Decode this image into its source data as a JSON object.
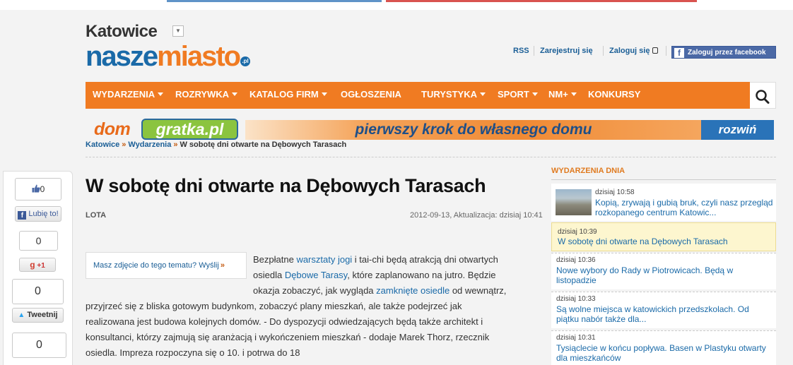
{
  "header": {
    "city": "Katowice",
    "logo_part1": "nasze",
    "logo_part2": "miasto",
    "logo_suffix": ".pl",
    "links": {
      "rss": "RSS",
      "register": "Zarejestruj się",
      "login": "Zaloguj się",
      "facebook_login": "Zaloguj przez facebook"
    }
  },
  "nav": {
    "items": [
      {
        "label": "WYDARZENIA"
      },
      {
        "label": "ROZRYWKA"
      },
      {
        "label": "KATALOG FIRM"
      },
      {
        "label": "OGŁOSZENIA"
      },
      {
        "label": "TURYSTYKA"
      },
      {
        "label": "SPORT"
      },
      {
        "label": "NM+"
      },
      {
        "label": "KONKURSY"
      }
    ]
  },
  "banner": {
    "dom": "dom",
    "gratka": "gratka.pl",
    "slogan": "pierwszy krok do własnego domu",
    "expand": "rozwiń"
  },
  "breadcrumb": {
    "home": "Katowice",
    "section": "Wydarzenia",
    "current": "W sobotę dni otwarte na Dębowych Tarasach"
  },
  "social": {
    "fb_count": "0",
    "fb_like": "Lubię to!",
    "gplus_count": "0",
    "gplus_label": "+1",
    "tweet_count": "0",
    "tweet_label": "Tweetnij",
    "other_count": "0"
  },
  "article": {
    "title": "W sobotę dni otwarte na Dębowych Tarasach",
    "author": "LOTA",
    "dates": "2012-09-13, Aktualizacja: dzisiaj 10:41",
    "photo_prompt": "Masz zdjęcie do tego tematu? Wyślij",
    "text": {
      "p1_a": "Bezpłatne ",
      "link_warsztaty": "warsztaty jogi",
      "p1_b": " i tai-chi będą atrakcją dni otwartych",
      "p2_a": "osiedla ",
      "link_debowe": "Dębowe Tarasy",
      "p2_b": ", które zaplanowano na jutro. Będzie",
      "p3_a": "okazja zobaczyć, jak wygląda ",
      "link_zamkniete": "zamknięte osiedle",
      "p3_b": " od wewnątrz,",
      "line4": "przyjrzeć się z bliska gotowym budynkom, zobaczyć plany mieszkań, ale także podejrzeć jak",
      "line5": "realizowana jest budowa kolejnych domów. - Do dyspozycji odwiedzających będą także architekt i",
      "line6": "konsultanci, którzy zajmują się aranżacją i wykończeniem mieszkań - dodaje Marek Thorz, rzecznik",
      "line7": "osiedla. Impreza rozpoczyna się o 10. i potrwa do 18"
    }
  },
  "sidebar": {
    "heading": "WYDARZENIA DNIA",
    "items": [
      {
        "time": "dzisiaj 10:58",
        "line1": "Kopią, zrywają i gubią bruk, czyli nasz przegląd",
        "line2": "rozkopanego centrum Katowic..."
      },
      {
        "time": "dzisiaj 10:39",
        "line1": "W sobotę dni otwarte na Dębowych Tarasach",
        "line2": ""
      },
      {
        "time": "dzisiaj 10:36",
        "line1": "Nowe wybory do Rady w Piotrowicach. Będą w",
        "line2": "listopadzie"
      },
      {
        "time": "dzisiaj 10:33",
        "line1": "Są wolne miejsca w katowickich przedszkolach. Od",
        "line2": "piątku nabór także dla..."
      },
      {
        "time": "dzisiaj 10:31",
        "line1": "Tysiąclecie w końcu popływa. Basen w Plastyku otwarty",
        "line2": "dla mieszkańców"
      }
    ]
  },
  "colors": {
    "brand_orange": "#f07b22",
    "brand_blue": "#1a6aa8",
    "link": "#1a6aa8"
  }
}
